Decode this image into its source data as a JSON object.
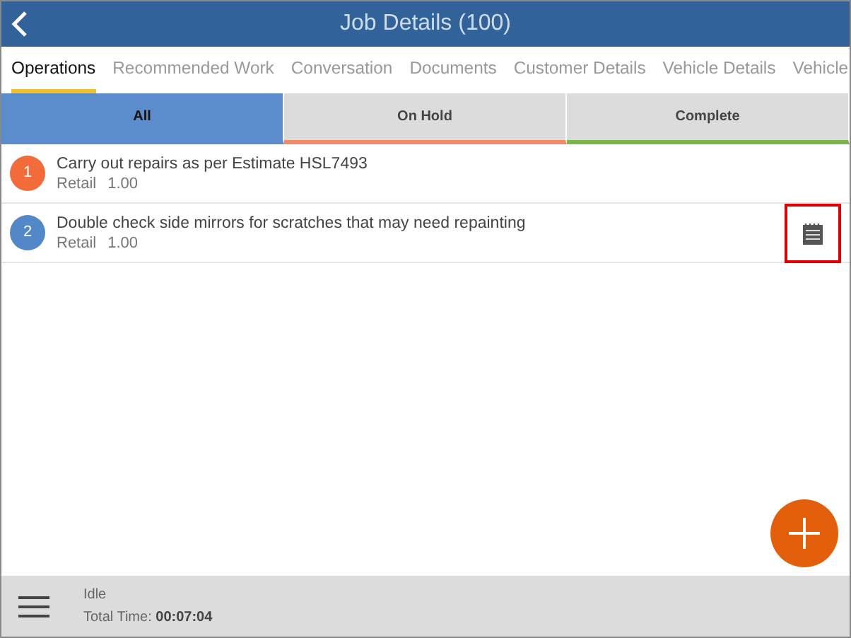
{
  "header": {
    "title": "Job Details (100)"
  },
  "tabs": [
    {
      "label": "Operations",
      "selected": true
    },
    {
      "label": "Recommended Work",
      "selected": false
    },
    {
      "label": "Conversation",
      "selected": false
    },
    {
      "label": "Documents",
      "selected": false
    },
    {
      "label": "Customer Details",
      "selected": false
    },
    {
      "label": "Vehicle Details",
      "selected": false
    },
    {
      "label": "Vehicle",
      "selected": false
    }
  ],
  "filters": [
    {
      "label": "All",
      "selected": true,
      "color": "#5b8ccb"
    },
    {
      "label": "On Hold",
      "selected": false,
      "color": "#f08a6a"
    },
    {
      "label": "Complete",
      "selected": false,
      "color": "#7ab648"
    }
  ],
  "operations": [
    {
      "number": "1",
      "color": "#f26b3a",
      "title": "Carry out repairs as per Estimate HSL7493",
      "rate_type": "Retail",
      "quantity": "1.00",
      "has_note": false,
      "highlighted": false
    },
    {
      "number": "2",
      "color": "#5288c8",
      "title": "Double check side mirrors for scratches that may need repainting",
      "rate_type": "Retail",
      "quantity": "1.00",
      "has_note": true,
      "highlighted": true
    }
  ],
  "footer": {
    "status": "Idle",
    "total_time_label": "Total Time:",
    "total_time": "00:07:04"
  }
}
